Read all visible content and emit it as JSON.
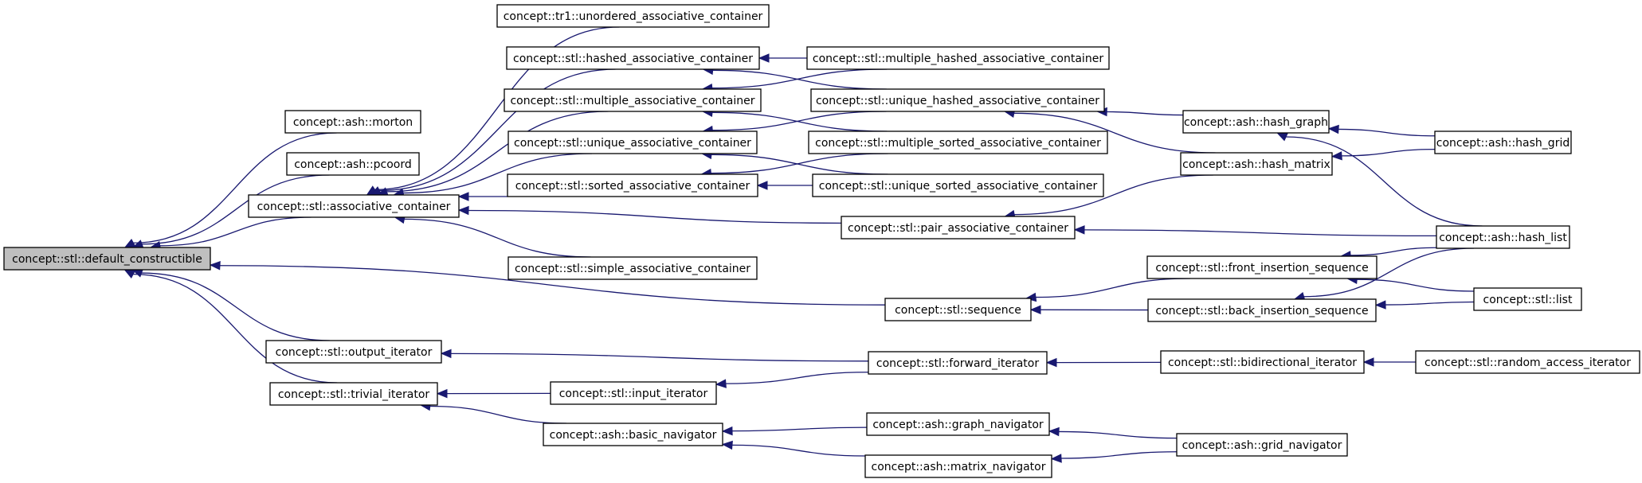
{
  "diagram": {
    "type": "inheritance-graph",
    "root": "default_constructible",
    "colors": {
      "edge": "#191970",
      "root_fill": "#bfbfbf",
      "node_fill": "#ffffff",
      "node_border": "#000000"
    },
    "nodes": [
      {
        "id": "default_constructible",
        "label": "concept::stl::default_constructible",
        "root": true
      },
      {
        "id": "morton",
        "label": "concept::ash::morton"
      },
      {
        "id": "pcoord",
        "label": "concept::ash::pcoord"
      },
      {
        "id": "associative_container",
        "label": "concept::stl::associative_container"
      },
      {
        "id": "output_iterator",
        "label": "concept::stl::output_iterator"
      },
      {
        "id": "trivial_iterator",
        "label": "concept::stl::trivial_iterator"
      },
      {
        "id": "tr1_unordered",
        "label": "concept::tr1::unordered_associative_container"
      },
      {
        "id": "hashed_assoc",
        "label": "concept::stl::hashed_associative_container"
      },
      {
        "id": "multiple_assoc",
        "label": "concept::stl::multiple_associative_container"
      },
      {
        "id": "unique_assoc",
        "label": "concept::stl::unique_associative_container"
      },
      {
        "id": "sorted_assoc",
        "label": "concept::stl::sorted_associative_container"
      },
      {
        "id": "simple_assoc",
        "label": "concept::stl::simple_associative_container"
      },
      {
        "id": "input_iterator",
        "label": "concept::stl::input_iterator"
      },
      {
        "id": "basic_navigator",
        "label": "concept::ash::basic_navigator"
      },
      {
        "id": "multiple_hashed",
        "label": "concept::stl::multiple_hashed_associative_container"
      },
      {
        "id": "unique_hashed",
        "label": "concept::stl::unique_hashed_associative_container"
      },
      {
        "id": "multiple_sorted",
        "label": "concept::stl::multiple_sorted_associative_container"
      },
      {
        "id": "unique_sorted",
        "label": "concept::stl::unique_sorted_associative_container"
      },
      {
        "id": "pair_assoc",
        "label": "concept::stl::pair_associative_container"
      },
      {
        "id": "sequence",
        "label": "concept::stl::sequence"
      },
      {
        "id": "forward_iterator",
        "label": "concept::stl::forward_iterator"
      },
      {
        "id": "graph_navigator",
        "label": "concept::ash::graph_navigator"
      },
      {
        "id": "matrix_navigator",
        "label": "concept::ash::matrix_navigator"
      },
      {
        "id": "hash_graph",
        "label": "concept::ash::hash_graph"
      },
      {
        "id": "hash_matrix",
        "label": "concept::ash::hash_matrix"
      },
      {
        "id": "front_insertion",
        "label": "concept::stl::front_insertion_sequence"
      },
      {
        "id": "back_insertion",
        "label": "concept::stl::back_insertion_sequence"
      },
      {
        "id": "bidirectional_iterator",
        "label": "concept::stl::bidirectional_iterator"
      },
      {
        "id": "grid_navigator",
        "label": "concept::ash::grid_navigator"
      },
      {
        "id": "hash_grid",
        "label": "concept::ash::hash_grid"
      },
      {
        "id": "hash_list",
        "label": "concept::ash::hash_list"
      },
      {
        "id": "list",
        "label": "concept::stl::list"
      },
      {
        "id": "random_access_iterator",
        "label": "concept::stl::random_access_iterator"
      }
    ],
    "edges": [
      {
        "from": "morton",
        "to": "default_constructible"
      },
      {
        "from": "pcoord",
        "to": "default_constructible"
      },
      {
        "from": "associative_container",
        "to": "default_constructible"
      },
      {
        "from": "sequence",
        "to": "default_constructible"
      },
      {
        "from": "output_iterator",
        "to": "default_constructible"
      },
      {
        "from": "trivial_iterator",
        "to": "default_constructible"
      },
      {
        "from": "tr1_unordered",
        "to": "associative_container"
      },
      {
        "from": "hashed_assoc",
        "to": "associative_container"
      },
      {
        "from": "multiple_assoc",
        "to": "associative_container"
      },
      {
        "from": "unique_assoc",
        "to": "associative_container"
      },
      {
        "from": "sorted_assoc",
        "to": "associative_container"
      },
      {
        "from": "pair_assoc",
        "to": "associative_container"
      },
      {
        "from": "simple_assoc",
        "to": "associative_container"
      },
      {
        "from": "multiple_hashed",
        "to": "hashed_assoc"
      },
      {
        "from": "unique_hashed",
        "to": "hashed_assoc"
      },
      {
        "from": "multiple_hashed",
        "to": "multiple_assoc"
      },
      {
        "from": "multiple_sorted",
        "to": "multiple_assoc"
      },
      {
        "from": "unique_hashed",
        "to": "unique_assoc"
      },
      {
        "from": "unique_sorted",
        "to": "unique_assoc"
      },
      {
        "from": "multiple_sorted",
        "to": "sorted_assoc"
      },
      {
        "from": "unique_sorted",
        "to": "sorted_assoc"
      },
      {
        "from": "hash_graph",
        "to": "unique_hashed"
      },
      {
        "from": "hash_matrix",
        "to": "unique_hashed"
      },
      {
        "from": "hash_matrix",
        "to": "pair_assoc"
      },
      {
        "from": "hash_list",
        "to": "pair_assoc"
      },
      {
        "from": "hash_grid",
        "to": "hash_graph"
      },
      {
        "from": "hash_list",
        "to": "hash_graph"
      },
      {
        "from": "hash_grid",
        "to": "hash_matrix"
      },
      {
        "from": "front_insertion",
        "to": "sequence"
      },
      {
        "from": "back_insertion",
        "to": "sequence"
      },
      {
        "from": "hash_list",
        "to": "front_insertion"
      },
      {
        "from": "list",
        "to": "front_insertion"
      },
      {
        "from": "hash_list",
        "to": "back_insertion"
      },
      {
        "from": "list",
        "to": "back_insertion"
      },
      {
        "from": "forward_iterator",
        "to": "output_iterator"
      },
      {
        "from": "forward_iterator",
        "to": "input_iterator"
      },
      {
        "from": "input_iterator",
        "to": "trivial_iterator"
      },
      {
        "from": "basic_navigator",
        "to": "trivial_iterator"
      },
      {
        "from": "bidirectional_iterator",
        "to": "forward_iterator"
      },
      {
        "from": "random_access_iterator",
        "to": "bidirectional_iterator"
      },
      {
        "from": "graph_navigator",
        "to": "basic_navigator"
      },
      {
        "from": "matrix_navigator",
        "to": "basic_navigator"
      },
      {
        "from": "grid_navigator",
        "to": "graph_navigator"
      },
      {
        "from": "grid_navigator",
        "to": "matrix_navigator"
      }
    ]
  }
}
